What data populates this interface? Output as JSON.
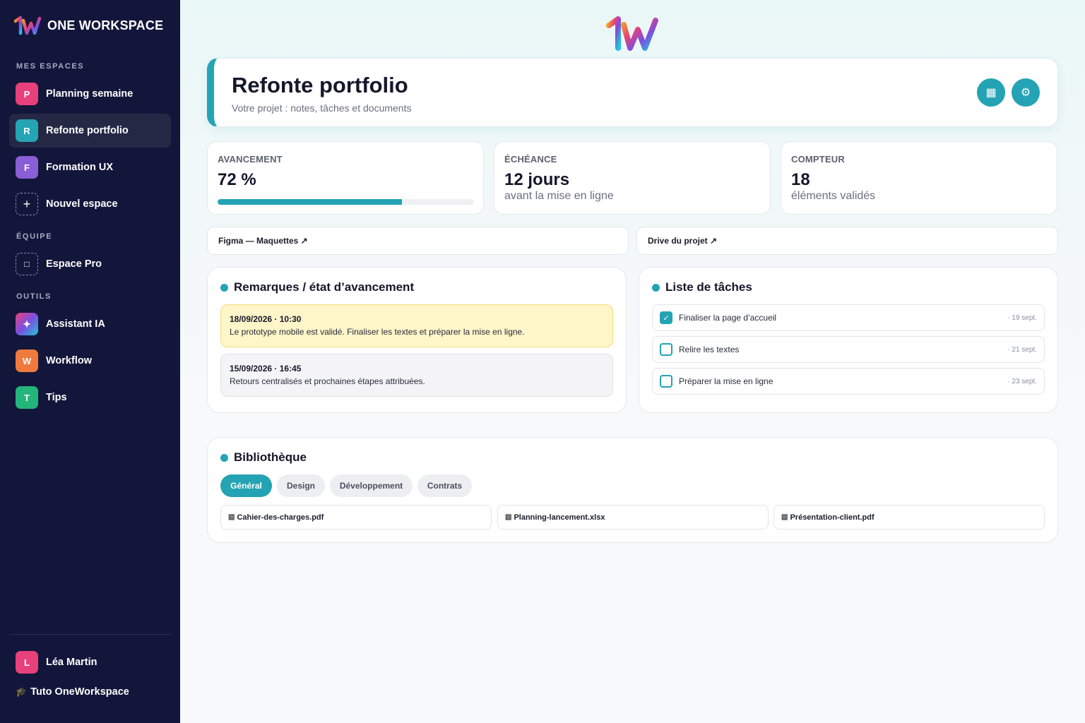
{
  "sidebar": {
    "brand": "ONE WORKSPACE",
    "sections": {
      "spaces": "MES ESPACES",
      "team": "ÉQUIPE",
      "tools": "OUTILS"
    },
    "spaces": [
      {
        "letter": "P",
        "label": "Planning semaine",
        "color": "#e8407a"
      },
      {
        "letter": "R",
        "label": "Refonte portfolio",
        "color": "#25a4b4"
      },
      {
        "letter": "F",
        "label": "Formation UX",
        "color": "#8a5ed6"
      },
      {
        "letter": "+",
        "label": "Nouvel espace"
      }
    ],
    "team": [
      {
        "letter": "□",
        "label": "Espace Pro"
      }
    ],
    "tools": [
      {
        "letter": "✦",
        "label": "Assistant IA"
      },
      {
        "letter": "W",
        "label": "Workflow",
        "color": "#f07a3e"
      },
      {
        "letter": "T",
        "label": "Tips",
        "color": "#23b57a"
      }
    ],
    "user": {
      "letter": "L",
      "name": "Léa Martin",
      "color": "#e8407a"
    },
    "tuto": "Tuto OneWorkspace",
    "tuto_icon": "🎓"
  },
  "project": {
    "title": "Refonte portfolio",
    "subtitle": "Votre projet : notes, tâches et documents",
    "btn_grid_icon": "▦",
    "btn_settings_icon": "⚙"
  },
  "stats": {
    "progress": {
      "label": "Avancement",
      "value": "72 %",
      "fraction": 0.72
    },
    "deadline": {
      "label": "Échéance",
      "value": "12 jours",
      "sub": "avant la mise en ligne"
    },
    "counter": {
      "label": "Compteur",
      "value": "18",
      "sub": "éléments validés"
    }
  },
  "links": {
    "figma": "Figma — Maquettes ↗",
    "drive": "Drive du projet ↗"
  },
  "remarks": {
    "title": "Remarques / état d’avancement",
    "notes": [
      {
        "date": "18/09/2026 · 10:30",
        "text": "Le prototype mobile est validé. Finaliser les textes et préparer la mise en ligne."
      },
      {
        "date": "15/09/2026 · 16:45",
        "text": "Retours centralisés et prochaines étapes attribuées."
      }
    ]
  },
  "tasks": {
    "title": "Liste de tâches",
    "items": [
      {
        "label": "Finaliser la page d’accueil",
        "date": "· 19 sept.",
        "done": true,
        "check": "✓"
      },
      {
        "label": "Relire les textes",
        "date": "· 21 sept.",
        "done": false
      },
      {
        "label": "Préparer la mise en ligne",
        "date": "· 23 sept.",
        "done": false
      }
    ]
  },
  "library": {
    "title": "Bibliothèque",
    "tabs": [
      "Général",
      "Design",
      "Développement",
      "Contrats"
    ],
    "file_icon": "▧",
    "files": [
      "Cahier-des-charges.pdf",
      "Planning-lancement.xlsx",
      "Présentation-client.pdf"
    ]
  },
  "colors": {
    "accent": "#23a3b3",
    "sidebar_bg": "#12163a"
  }
}
